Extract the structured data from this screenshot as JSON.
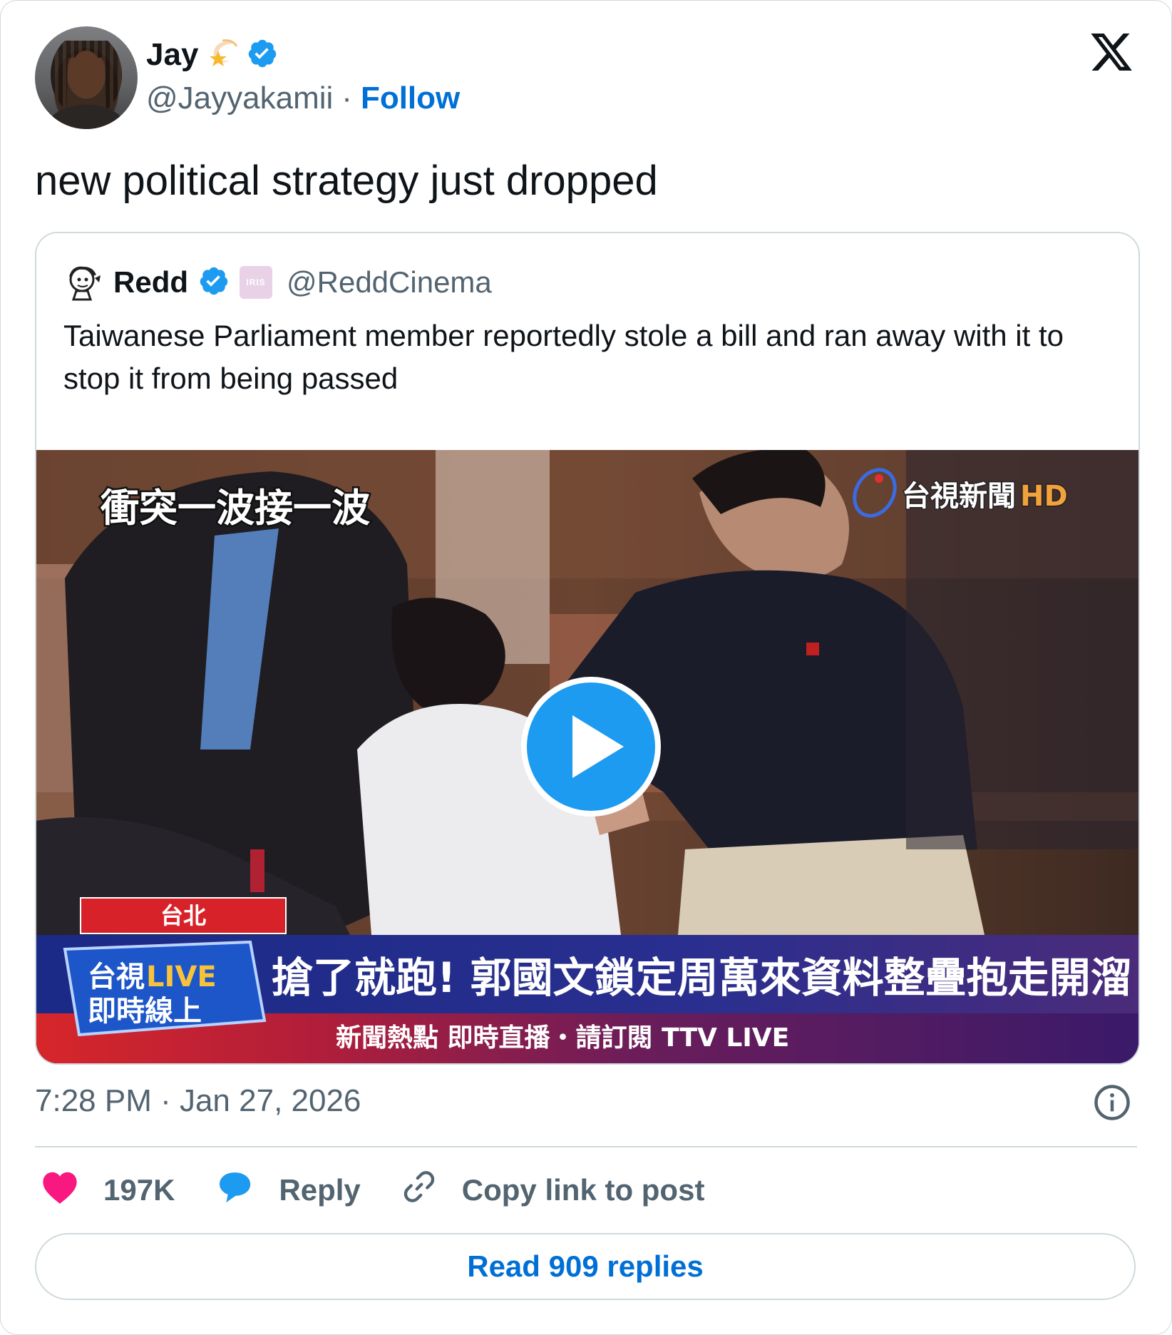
{
  "author": {
    "name": "Jay",
    "handle": "@Jayyakamii",
    "separator": "·",
    "follow_label": "Follow",
    "name_emoji": "💫"
  },
  "tweet": {
    "text": "new political strategy just dropped"
  },
  "quoted": {
    "name": "Redd",
    "badge_text": "IRIS",
    "handle": "@ReddCinema",
    "text": "Taiwanese Parliament member reportedly stole a bill and ran away with it to stop it from being passed",
    "video": {
      "caption_top": "衝突一波接一波",
      "channel": "台視新聞",
      "channel_hd": "HD",
      "location_tag": "台北",
      "live_line1_a": "台視",
      "live_line1_b": "LIVE",
      "live_line2": "即時線上",
      "headline": "搶了就跑! 郭國文鎖定周萬來資料整疊抱走開溜",
      "ticker": "新聞熱點  即時直播・請訂閱 TTV LIVE"
    }
  },
  "timestamp": "7:28 PM · Jan 27, 2026",
  "actions": {
    "likes": "197K",
    "reply_label": "Reply",
    "copy_label": "Copy link to post"
  },
  "read_replies_label": "Read 909 replies",
  "colors": {
    "link_blue": "#006fd6",
    "verified_blue": "#1d9bf0",
    "like_pink": "#f91880",
    "muted_gray": "#536471",
    "border": "#cfd9de"
  }
}
